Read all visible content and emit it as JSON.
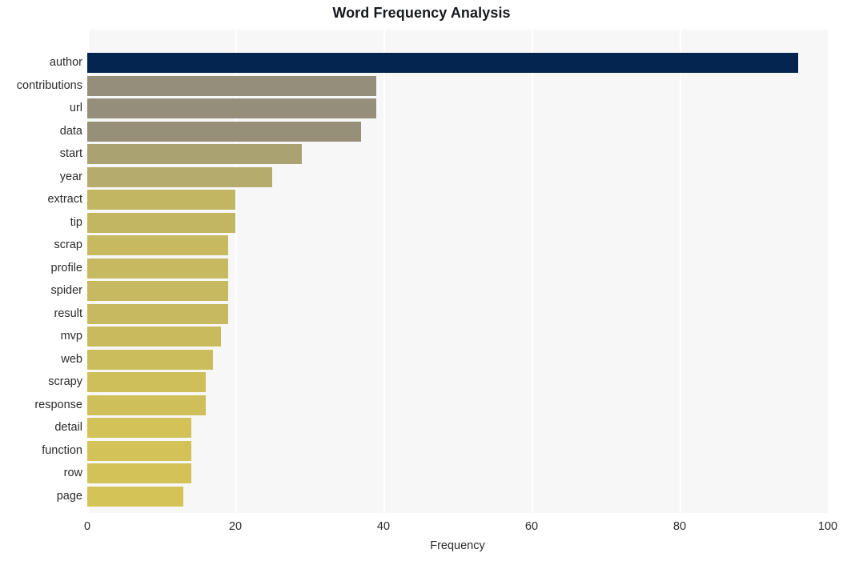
{
  "chart_data": {
    "type": "bar",
    "orientation": "horizontal",
    "title": "Word Frequency Analysis",
    "xlabel": "Frequency",
    "ylabel": "",
    "xlim": [
      0,
      100
    ],
    "xticks": [
      0,
      20,
      40,
      60,
      80,
      100
    ],
    "xtick_labels": [
      "0",
      "20",
      "40",
      "60",
      "80",
      "100"
    ],
    "grid": true,
    "grid_axis": "x",
    "legend": false,
    "categories": [
      "author",
      "contributions",
      "url",
      "data",
      "start",
      "year",
      "extract",
      "tip",
      "scrap",
      "profile",
      "spider",
      "result",
      "mvp",
      "web",
      "scrapy",
      "response",
      "detail",
      "function",
      "row",
      "page"
    ],
    "values": [
      96,
      39,
      39,
      37,
      29,
      25,
      20,
      20,
      19,
      19,
      19,
      19,
      18,
      17,
      16,
      16,
      14,
      14,
      14,
      13
    ],
    "bar_colors": [
      "#04254f",
      "#948e7b",
      "#948e7b",
      "#969078",
      "#aba272",
      "#b5ab6c",
      "#c2b663",
      "#c2b663",
      "#c6b95f",
      "#c6b95f",
      "#c6b95f",
      "#c6b95f",
      "#c9bb5d",
      "#cbbd5c",
      "#cebf5a",
      "#cebf5a",
      "#d2c258",
      "#d2c258",
      "#d2c258",
      "#d4c357"
    ],
    "plot_background": "#f7f7f7",
    "grid_color": "#ffffff",
    "figure_background": "#ffffff",
    "text_color": "#2b2b2b",
    "title_color": "#16181c"
  }
}
